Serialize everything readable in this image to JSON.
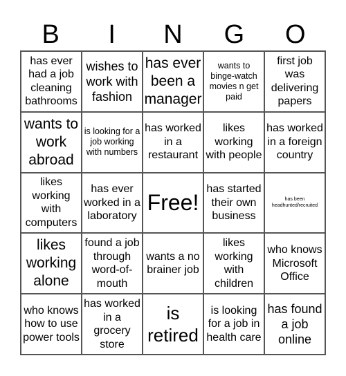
{
  "header": {
    "letters": [
      "B",
      "I",
      "N",
      "G",
      "O"
    ]
  },
  "cells": [
    {
      "text": "has ever had a job cleaning bathrooms",
      "size": "md"
    },
    {
      "text": "wishes to work with fashion",
      "size": "lg"
    },
    {
      "text": "has ever been a manager",
      "size": "xl"
    },
    {
      "text": "wants to binge-watch movies n get paid",
      "size": "sm"
    },
    {
      "text": "first job was delivering papers",
      "size": "md"
    },
    {
      "text": "wants to work abroad",
      "size": "xl"
    },
    {
      "text": "is looking for a job working with numbers",
      "size": "sm"
    },
    {
      "text": "has worked in a restaurant",
      "size": "md"
    },
    {
      "text": "likes working with people",
      "size": "md"
    },
    {
      "text": "has worked in a foreign country",
      "size": "md"
    },
    {
      "text": "likes working with computers",
      "size": "md"
    },
    {
      "text": "has ever worked in a laboratory",
      "size": "md"
    },
    {
      "text": "Free!",
      "size": "free"
    },
    {
      "text": "has started their own business",
      "size": "md"
    },
    {
      "text": "has been headhunted/recruited",
      "size": "xs"
    },
    {
      "text": "likes working alone",
      "size": "xl"
    },
    {
      "text": "found a job through word-of-mouth",
      "size": "md"
    },
    {
      "text": "wants a no brainer job",
      "size": "md"
    },
    {
      "text": "likes working with children",
      "size": "md"
    },
    {
      "text": "who knows Microsoft Office",
      "size": "md"
    },
    {
      "text": "who knows how to use power tools",
      "size": "md"
    },
    {
      "text": "has worked in a grocery store",
      "size": "md"
    },
    {
      "text": "is retired",
      "size": "xxl"
    },
    {
      "text": "is looking for a job in health care",
      "size": "md"
    },
    {
      "text": "has found a job online",
      "size": "lg"
    }
  ]
}
